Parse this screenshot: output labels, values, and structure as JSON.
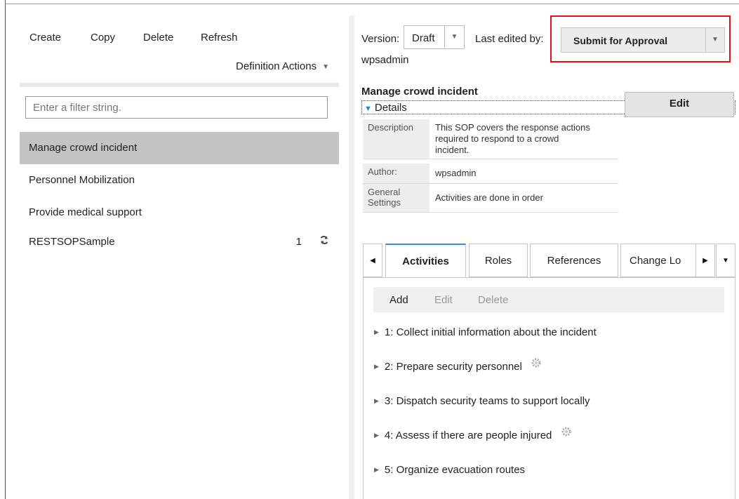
{
  "left": {
    "toolbar": {
      "create": "Create",
      "copy": "Copy",
      "delete": "Delete",
      "refresh": "Refresh"
    },
    "definition_actions": "Definition Actions",
    "filter_placeholder": "Enter a filter string.",
    "sops": [
      {
        "name": "Manage crowd incident",
        "selected": true
      },
      {
        "name": "Personnel Mobilization"
      },
      {
        "name": "Provide medical support"
      },
      {
        "name": "RESTSOPSample",
        "count": "1",
        "icon": "sync-icon"
      }
    ]
  },
  "right": {
    "version_label": "Version:",
    "version_value": "Draft",
    "last_edited_label": "Last edited by:",
    "editor": "wpsadmin",
    "submit_label": "Submit for Approval",
    "highlight_color": "#e0121b",
    "sop_title": "Manage crowd incident",
    "details_label": "Details",
    "edit_label": "Edit",
    "details": {
      "description_key": "Description",
      "description_value": "This SOP covers the response actions required to respond to a crowd incident.",
      "author_key": "Author:",
      "author_value": "wpsadmin",
      "general_key": "General Settings",
      "general_value": "Activities are done in order"
    },
    "tabs": [
      "Activities",
      "Roles",
      "References",
      "Change Lo"
    ],
    "active_tab": "Activities",
    "activity_toolbar": {
      "add": "Add",
      "edit": "Edit",
      "delete": "Delete"
    },
    "activities": [
      {
        "label": "1: Collect initial information about the incident",
        "gear": false
      },
      {
        "label": "2: Prepare security personnel",
        "gear": true
      },
      {
        "label": "3: Dispatch security teams to support locally",
        "gear": false
      },
      {
        "label": "4: Assess if there are people injured",
        "gear": true
      },
      {
        "label": "5: Organize evacuation routes",
        "gear": false
      }
    ]
  }
}
